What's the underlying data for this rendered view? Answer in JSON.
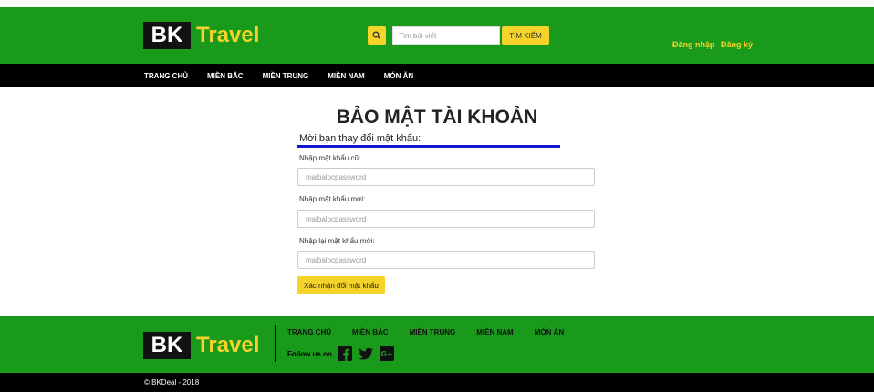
{
  "header": {
    "logo_bk": "BK",
    "logo_travel": "Travel",
    "search_placeholder": "Tìm bài viết",
    "search_button": "TÌM KIẾM",
    "login": "Đăng nhập",
    "register": "Đăng ký"
  },
  "nav": {
    "items": [
      "TRANG CHỦ",
      "MIỀN BẮC",
      "MIỀN TRUNG",
      "MIỀN NAM",
      "MÓN ĂN"
    ]
  },
  "main": {
    "title": "BẢO MẬT TÀI KHOẢN",
    "subtitle": "Mời bạn thay đổi mật khẩu:",
    "old_password_label": "Nhập mật khẩu cũ:",
    "old_password_placeholder": "maibalocpassword",
    "new_password_label": "Nhập mật khẩu mới:",
    "new_password_placeholder": "maibalocpassword",
    "confirm_password_label": "Nhập lại mật khẩu mới:",
    "confirm_password_placeholder": "maibalocpassword",
    "confirm_button": "Xác nhận đổi mật khẩu"
  },
  "footer": {
    "logo_bk": "BK",
    "logo_travel": "Travel",
    "links": [
      "TRANG CHỦ",
      "MIỀN BẮC",
      "MIỀN TRUNG",
      "MIỀN NAM",
      "MÓN ĂN"
    ],
    "follow_us": "Follow us on",
    "social_icons": [
      "facebook-icon",
      "twitter-icon",
      "google-plus-icon"
    ],
    "copyright": "© BKDeal - 2018"
  },
  "colors": {
    "green": "#1a9a1a",
    "yellow": "#f5d32a",
    "black": "#000000",
    "blue_underline": "#1515d4"
  }
}
